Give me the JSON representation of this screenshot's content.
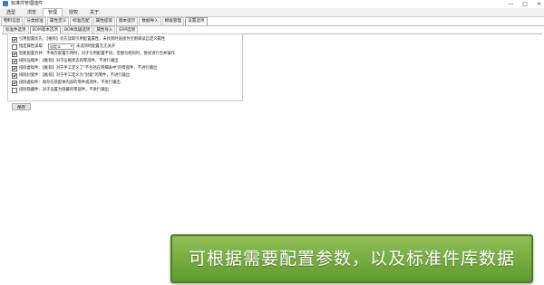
{
  "window": {
    "title": "标准件管理插件",
    "controls": [
      "—",
      "□",
      "✕"
    ]
  },
  "main_tabs": [
    {
      "label": "选型"
    },
    {
      "label": "浏览"
    },
    {
      "label": "管理"
    },
    {
      "label": "授权"
    },
    {
      "label": "关于"
    }
  ],
  "sub_tabs": [
    {
      "label": "物料信息"
    },
    {
      "label": "分类标准"
    },
    {
      "label": "属性定义"
    },
    {
      "label": "标准匹配"
    },
    {
      "label": "属性提取"
    },
    {
      "label": "版本提示"
    },
    {
      "label": "数据导入"
    },
    {
      "label": "模板管理"
    },
    {
      "label": "设置选项"
    }
  ],
  "third_tabs": [
    {
      "label": "标准件选项"
    },
    {
      "label": "BOM基本选项"
    },
    {
      "label": "BOM高级选项"
    },
    {
      "label": "属性导入"
    },
    {
      "label": "ERP选项"
    }
  ],
  "options": [
    {
      "checked": true,
      "text": "引用配置优先：【推荐】优先读取引用配置属性，未找到时直接为空则调读自定义属性"
    },
    {
      "checked": false,
      "text_before": "指定属性读取：",
      "select_value": "自定义",
      "text_after": "未选项时配置无无关开"
    },
    {
      "checked": true,
      "text": "智能配置合并：不拖完配置引用时，对于引用配置不同，但图号相同时，尝试进行合并操作"
    },
    {
      "checked": true,
      "text": "排除压缩件：【推荐】对于压缩状态的零部件，不进行输出"
    },
    {
      "checked": true,
      "text": "排除虚拟件：【推荐】对于手工定义了\"不包括在明细表中\"的零部件，不进行输出"
    },
    {
      "checked": true,
      "text": "排除封套件：【推荐】对于手工定义为\"封套\"的零件，不进行输出"
    },
    {
      "checked": true,
      "text": "排除虚拟件：保存在装配体内部的零件或部件，不进行输出"
    },
    {
      "checked": false,
      "text": "排除隐藏件：对于设置为隐藏的零部件，不进行输出"
    }
  ],
  "save_label": "保存",
  "banner": {
    "text": "可根据需要配置参数，以及标准件库数据"
  }
}
